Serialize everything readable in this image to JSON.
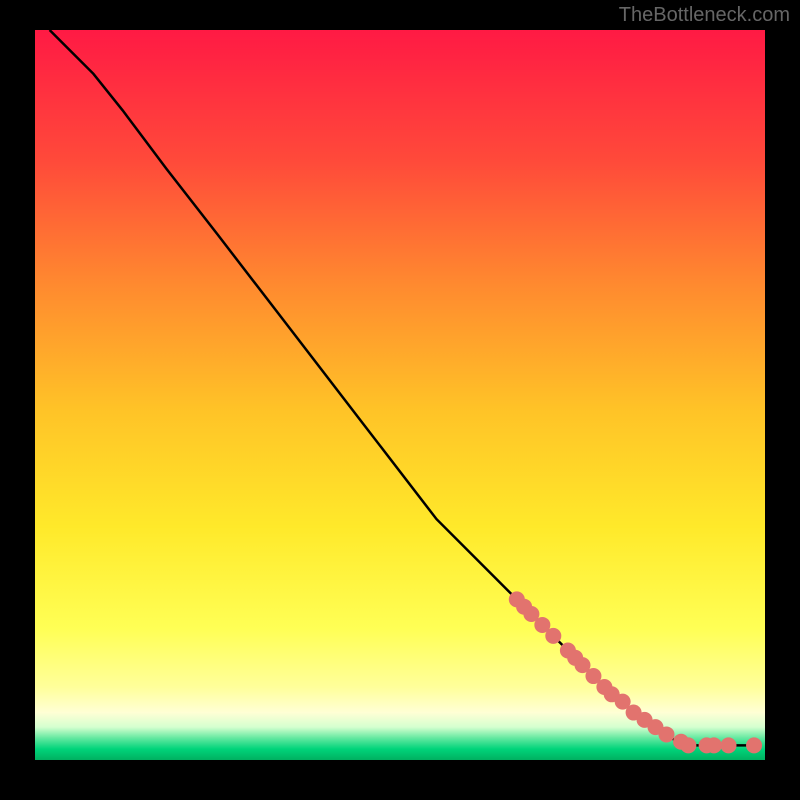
{
  "watermark": "TheBottleneck.com",
  "chart_data": {
    "type": "line",
    "title": "",
    "xlabel": "",
    "ylabel": "",
    "xlim": [
      0,
      100
    ],
    "ylim": [
      0,
      100
    ],
    "curve": {
      "comment": "Descending curve from top-left to bottom-right; x 0..100 maps to plot width, y 0..100 maps to plot height (0 at bottom)",
      "points": [
        {
          "x": 2,
          "y": 100
        },
        {
          "x": 4,
          "y": 98
        },
        {
          "x": 8,
          "y": 94
        },
        {
          "x": 12,
          "y": 89
        },
        {
          "x": 18,
          "y": 81
        },
        {
          "x": 25,
          "y": 72
        },
        {
          "x": 35,
          "y": 59
        },
        {
          "x": 45,
          "y": 46
        },
        {
          "x": 55,
          "y": 33
        },
        {
          "x": 65,
          "y": 23
        },
        {
          "x": 72,
          "y": 16
        },
        {
          "x": 78,
          "y": 10
        },
        {
          "x": 84,
          "y": 5
        },
        {
          "x": 88,
          "y": 2.5
        },
        {
          "x": 90,
          "y": 2
        },
        {
          "x": 95,
          "y": 2
        },
        {
          "x": 99,
          "y": 2
        }
      ]
    },
    "markers": {
      "comment": "Pink circular markers clustered along lower-right portion of curve",
      "color": "#e2736e",
      "radius_px": 8,
      "points": [
        {
          "x": 66,
          "y": 22
        },
        {
          "x": 67,
          "y": 21
        },
        {
          "x": 68,
          "y": 20
        },
        {
          "x": 69.5,
          "y": 18.5
        },
        {
          "x": 71,
          "y": 17
        },
        {
          "x": 73,
          "y": 15
        },
        {
          "x": 74,
          "y": 14
        },
        {
          "x": 75,
          "y": 13
        },
        {
          "x": 76.5,
          "y": 11.5
        },
        {
          "x": 78,
          "y": 10
        },
        {
          "x": 79,
          "y": 9
        },
        {
          "x": 80.5,
          "y": 8
        },
        {
          "x": 82,
          "y": 6.5
        },
        {
          "x": 83.5,
          "y": 5.5
        },
        {
          "x": 85,
          "y": 4.5
        },
        {
          "x": 86.5,
          "y": 3.5
        },
        {
          "x": 88.5,
          "y": 2.5
        },
        {
          "x": 89.5,
          "y": 2
        },
        {
          "x": 92,
          "y": 2
        },
        {
          "x": 93,
          "y": 2
        },
        {
          "x": 95,
          "y": 2
        },
        {
          "x": 98.5,
          "y": 2
        }
      ]
    },
    "background_gradient": {
      "comment": "vertical gradient top->bottom inside plot area",
      "stops": [
        {
          "offset": 0.0,
          "color": "#ff1a44"
        },
        {
          "offset": 0.18,
          "color": "#ff4a3a"
        },
        {
          "offset": 0.35,
          "color": "#ff8a2f"
        },
        {
          "offset": 0.52,
          "color": "#ffc327"
        },
        {
          "offset": 0.68,
          "color": "#ffe92a"
        },
        {
          "offset": 0.82,
          "color": "#ffff55"
        },
        {
          "offset": 0.9,
          "color": "#ffff9a"
        },
        {
          "offset": 0.935,
          "color": "#ffffd5"
        },
        {
          "offset": 0.955,
          "color": "#d4ffcf"
        },
        {
          "offset": 0.97,
          "color": "#63e8a0"
        },
        {
          "offset": 0.985,
          "color": "#00d47a"
        },
        {
          "offset": 1.0,
          "color": "#00b060"
        }
      ]
    }
  }
}
